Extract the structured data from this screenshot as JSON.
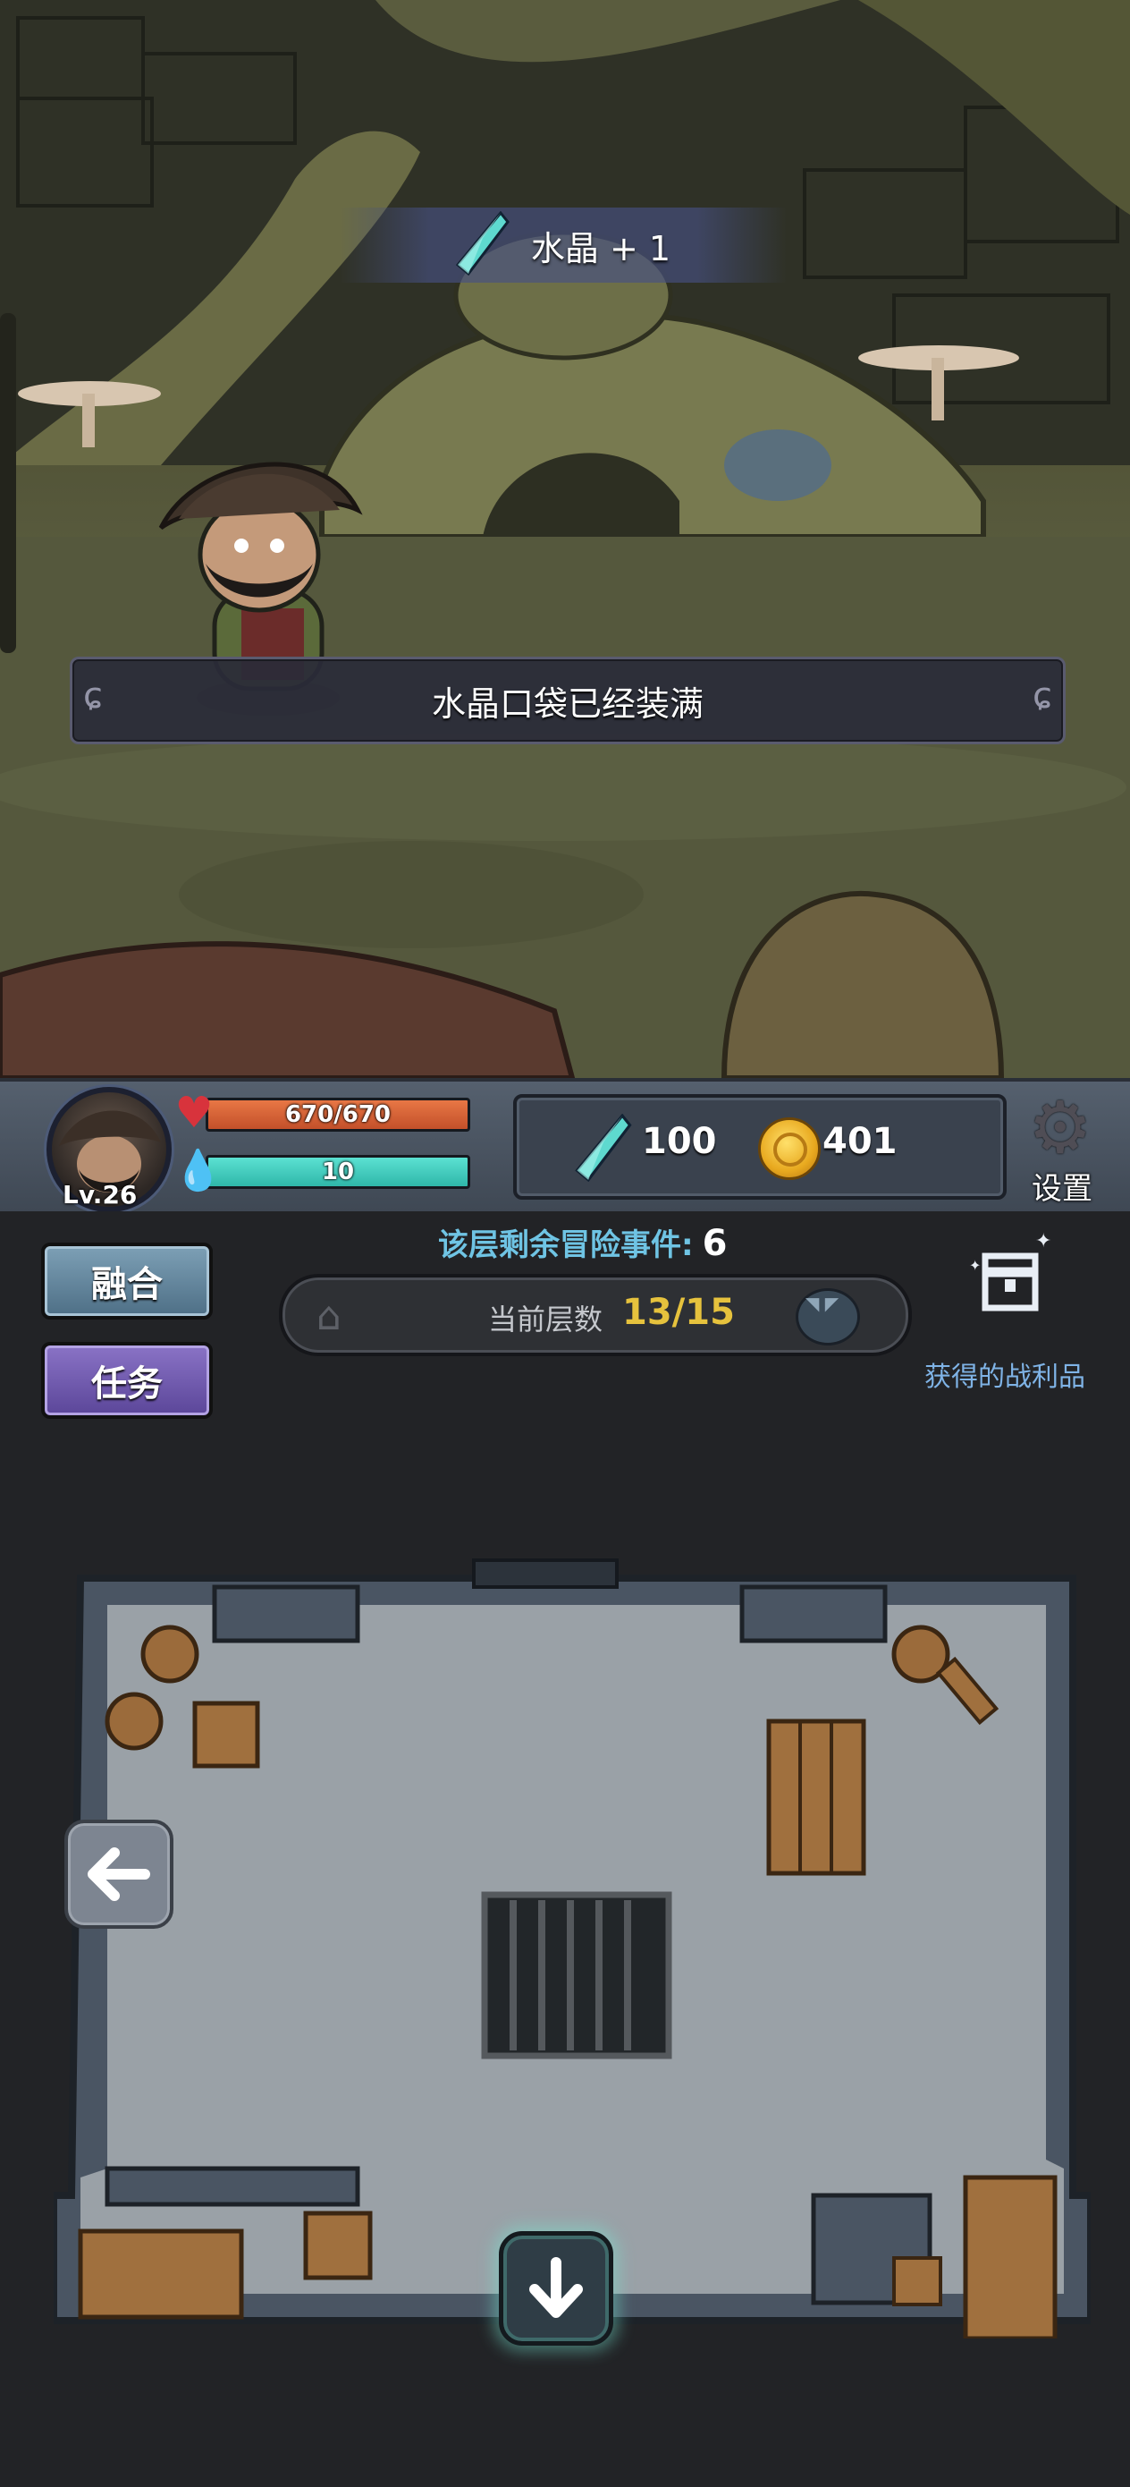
{
  "notification": {
    "item_gain": "水晶 + 1",
    "message": "水晶口袋已经装满"
  },
  "player": {
    "level": "Lv.26",
    "hp": "670/670",
    "hp_fraction": 1.0,
    "mp": "10",
    "mp_fraction": 1.0
  },
  "resources": {
    "crystals": "100",
    "gold": "401"
  },
  "settings": {
    "label": "设置"
  },
  "buttons": {
    "fuse": "融合",
    "task": "任务"
  },
  "floor": {
    "remaining_label": "该层剩余冒险事件:",
    "remaining_count": "6",
    "current_label": "当前层数",
    "current_value": "13/15"
  },
  "loot": {
    "label": "获得的战利品"
  },
  "icons": {
    "crystal": "crystal-icon",
    "heart": "heart-icon",
    "mana": "mana-drop-icon",
    "coin": "gold-coin-icon",
    "gear": "gear-icon",
    "house": "house-icon",
    "boss": "boss-demon-icon",
    "chest": "treasure-chest-icon",
    "back": "arrow-left-icon",
    "down": "arrow-down-icon"
  },
  "colors": {
    "hp_bar": "#d2603a",
    "mp_bar": "#45cfc0",
    "fuse_button": "#5f82a0",
    "task_button": "#6c55b0",
    "floor_value": "#e6c23d",
    "remaining_label": "#6fc4e4",
    "loot_label": "#7fb3e6"
  }
}
